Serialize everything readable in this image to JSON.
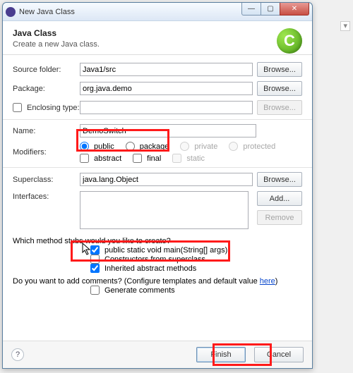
{
  "titlebar": {
    "title": "New Java Class"
  },
  "banner": {
    "heading": "Java Class",
    "sub": "Create a new Java class.",
    "icon_letter": "C"
  },
  "labels": {
    "source_folder": "Source folder:",
    "package": "Package:",
    "enclosing": "Enclosing type:",
    "name": "Name:",
    "modifiers": "Modifiers:",
    "superclass": "Superclass:",
    "interfaces": "Interfaces:",
    "stubs_q": "Which method stubs would you like to create?",
    "comments_q": "Do you want to add comments? (Configure templates and default value ",
    "here": "here",
    "comments_q_tail": ")"
  },
  "fields": {
    "source_folder": "Java1/src",
    "package": "org.java.demo",
    "enclosing": "",
    "name": "DemoSwitch",
    "superclass": "java.lang.Object"
  },
  "buttons": {
    "browse": "Browse...",
    "add": "Add...",
    "remove": "Remove",
    "finish": "Finish",
    "cancel": "Cancel"
  },
  "mods": {
    "public": "public",
    "package": "package",
    "private": "private",
    "protected": "protected",
    "abstract": "abstract",
    "final": "final",
    "static": "static"
  },
  "stubs": {
    "main": "public static void main(String[] args)",
    "super_ctor": "Constructors from superclass",
    "inherited": "Inherited abstract methods"
  },
  "gen_comments": "Generate comments",
  "win": {
    "min": "—",
    "max": "▢",
    "close": "✕"
  }
}
